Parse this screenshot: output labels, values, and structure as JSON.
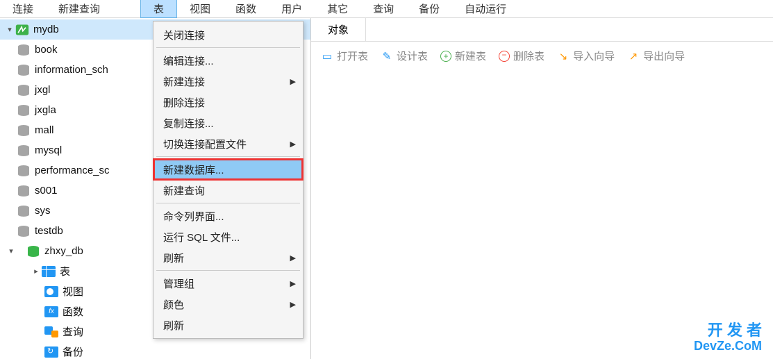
{
  "top_menu": {
    "connect": "连接",
    "new_query": "新建查询",
    "table": "表",
    "view": "视图",
    "function": "函数",
    "user": "用户",
    "other": "其它",
    "query": "查询",
    "backup": "备份",
    "auto_run": "自动运行"
  },
  "sidebar": {
    "conn": "mydb",
    "dbs": {
      "book": "book",
      "information_schema": "information_sch",
      "jxgl": "jxgl",
      "jxgla": "jxgla",
      "mall": "mall",
      "mysql": "mysql",
      "performance_schema": "performance_sc",
      "s001": "s001",
      "sys": "sys",
      "testdb": "testdb",
      "zhxy_db": "zhxy_db"
    },
    "children": {
      "table": "表",
      "view": "视图",
      "function": "函数",
      "query": "查询",
      "backup": "备份"
    }
  },
  "context_menu": {
    "close_conn": "关闭连接",
    "edit_conn": "编辑连接...",
    "new_conn": "新建连接",
    "del_conn": "删除连接",
    "copy_conn": "复制连接...",
    "switch_profile": "切换连接配置文件",
    "new_db": "新建数据库...",
    "new_query": "新建查询",
    "cli": "命令列界面...",
    "run_sql": "运行 SQL 文件...",
    "refresh": "刷新",
    "manage_group": "管理组",
    "color": "颜色",
    "refresh2": "刷新"
  },
  "content": {
    "tab_objects": "对象",
    "toolbar": {
      "open": "打开表",
      "design": "设计表",
      "new": "新建表",
      "delete": "删除表",
      "import": "导入向导",
      "export": "导出向导"
    }
  },
  "watermark": {
    "line1": "开 发 者",
    "line2": "DevZe.CoM"
  }
}
